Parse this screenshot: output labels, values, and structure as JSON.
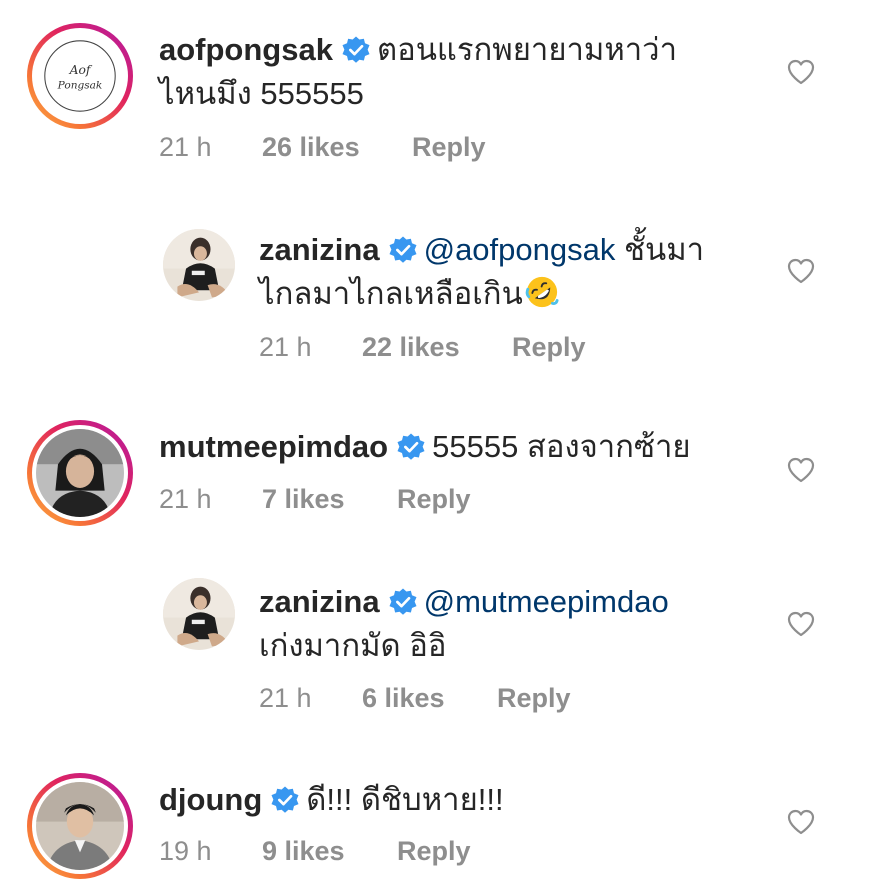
{
  "comments": [
    {
      "username": "aofpongsak",
      "line1": "ตอนแรกพยายามหาว่า",
      "line2": "ไหนมึง 555555",
      "time": "21 h",
      "likes": "26 likes",
      "reply": "Reply",
      "avatar_text": "Aof Pongsak"
    },
    {
      "username": "zanizina",
      "mention": "@aofpongsak",
      "line1": "ชั้นมา",
      "line2": "ไกลมาไกลเหลือเกิน",
      "time": "21 h",
      "likes": "22 likes",
      "reply": "Reply"
    },
    {
      "username": "mutmeepimdao",
      "line1": "55555 สองจากซ้าย",
      "time": "21 h",
      "likes": "7 likes",
      "reply": "Reply"
    },
    {
      "username": "zanizina",
      "mention": "@mutmeepimdao",
      "line2": "เก่งมากมัด อิอิ",
      "time": "21 h",
      "likes": "6 likes",
      "reply": "Reply"
    },
    {
      "username": "djoung",
      "line1": "ดี!!! ดีชิบหาย!!!",
      "time": "19 h",
      "likes": "9 likes",
      "reply": "Reply"
    }
  ],
  "icons": {
    "verified": "verified-badge-icon",
    "heart": "heart-outline-icon",
    "emoji": "rolling-on-floor-laughing-emoji"
  },
  "colors": {
    "verified": "#3897f0",
    "mention": "#00376b",
    "meta": "#8e8e8e",
    "text": "#262626"
  }
}
